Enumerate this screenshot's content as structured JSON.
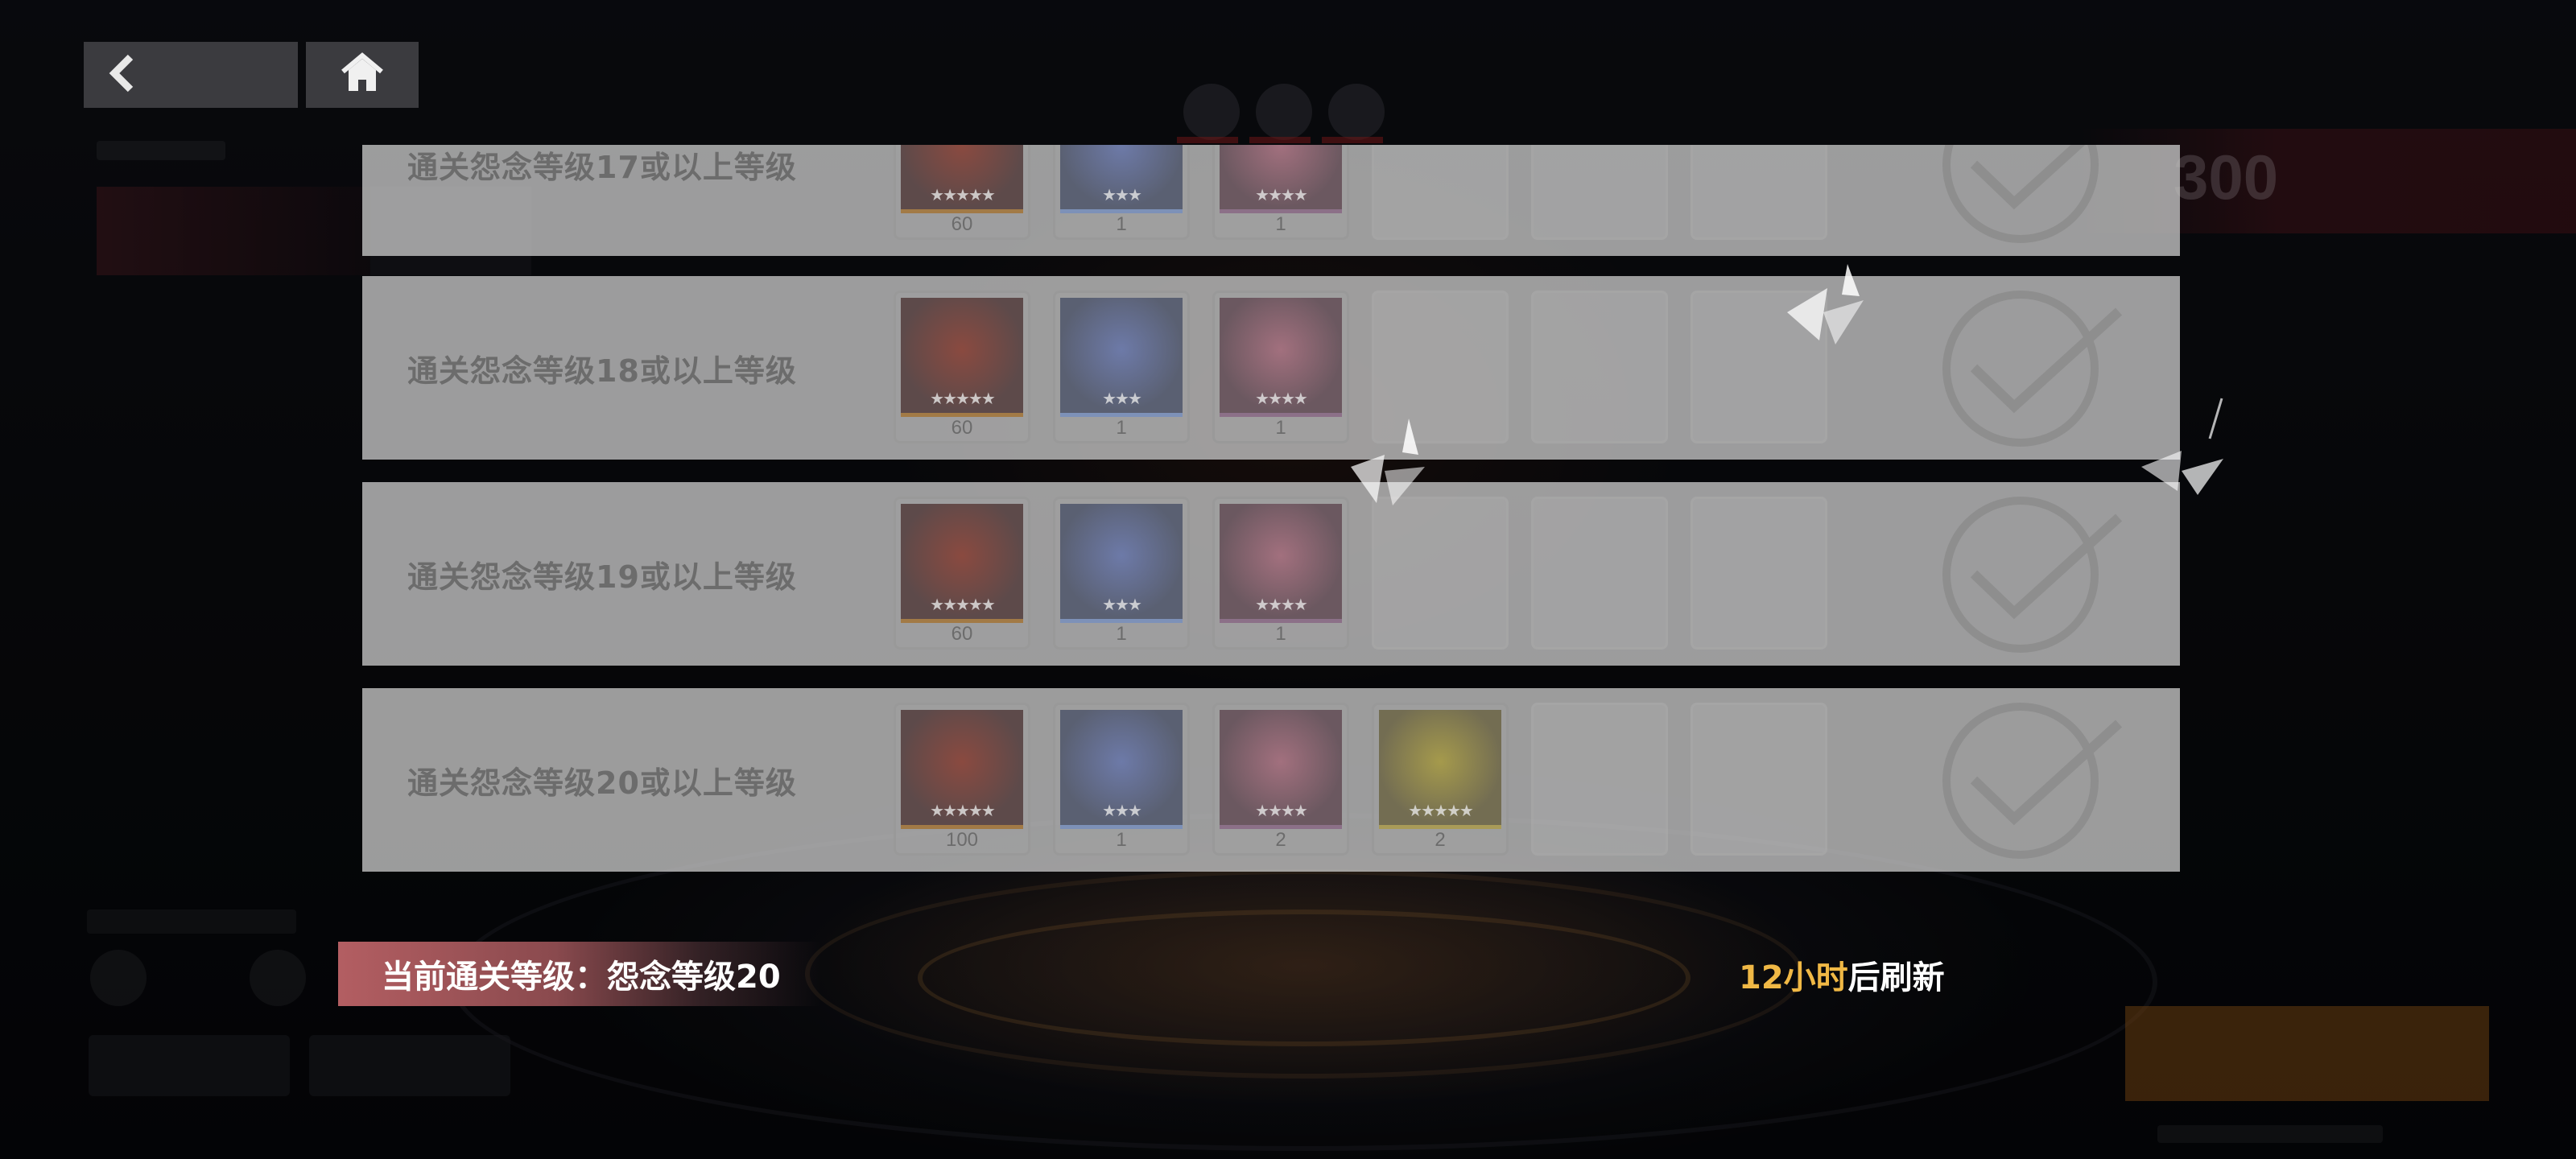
{
  "nav": {
    "back_icon": "chevron-left-icon",
    "home_icon": "home-icon"
  },
  "rewards": [
    {
      "label": "通关怨念等级17或以上等级",
      "items": [
        {
          "color": "red",
          "stars": "★★★★★",
          "count": "60"
        },
        {
          "color": "blue",
          "stars": "★★★",
          "count": "1"
        },
        {
          "color": "pink",
          "stars": "★★★★",
          "count": "1"
        }
      ],
      "claimed": true
    },
    {
      "label": "通关怨念等级18或以上等级",
      "items": [
        {
          "color": "red",
          "stars": "★★★★★",
          "count": "60"
        },
        {
          "color": "blue",
          "stars": "★★★",
          "count": "1"
        },
        {
          "color": "pink",
          "stars": "★★★★",
          "count": "1"
        }
      ],
      "claimed": true
    },
    {
      "label": "通关怨念等级19或以上等级",
      "items": [
        {
          "color": "red",
          "stars": "★★★★★",
          "count": "60"
        },
        {
          "color": "blue",
          "stars": "★★★",
          "count": "1"
        },
        {
          "color": "pink",
          "stars": "★★★★",
          "count": "1"
        }
      ],
      "claimed": true
    },
    {
      "label": "通关怨念等级20或以上等级",
      "items": [
        {
          "color": "red",
          "stars": "★★★★★",
          "count": "100"
        },
        {
          "color": "blue",
          "stars": "★★★",
          "count": "1"
        },
        {
          "color": "pink",
          "stars": "★★★★",
          "count": "2"
        },
        {
          "color": "gold",
          "stars": "★★★★★",
          "count": "2"
        }
      ],
      "claimed": true
    }
  ],
  "status": {
    "current_level": "当前通关等级：怨念等级20",
    "refresh_hours": "12小时",
    "refresh_suffix": "后刷新"
  },
  "colors": {
    "row_bg": "#c6c6c6",
    "label_text": "#6c6c6c",
    "banner": "#b35e62",
    "highlight": "#f0b845"
  }
}
